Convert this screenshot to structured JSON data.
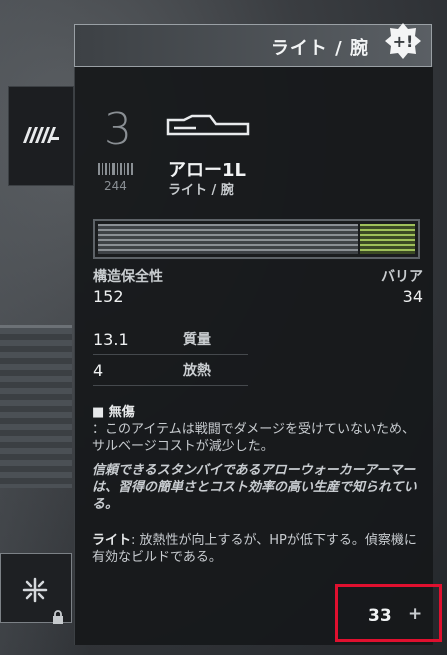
{
  "header": {
    "title": "ライト / 腕"
  },
  "item": {
    "tier": "3",
    "serial": "244",
    "name": "アロー1L",
    "subtitle": "ライト / 腕",
    "durability_fraction": 0.82,
    "barrier_fraction": 0.18
  },
  "stats": {
    "structure_label": "構造保全性",
    "structure_value": "152",
    "barrier_label": "バリア",
    "barrier_value": "34",
    "mass_value": "13.1",
    "mass_label": "質量",
    "heat_value": "4",
    "heat_label": "放熱"
  },
  "description": {
    "condition_title": "■ 無傷",
    "condition_text": "：このアイテムは戦闘でダメージを受けていないため、サルベージコストが減少した。",
    "flavor_text": "信頼できるスタンバイであるアローウォーカーアーマーは、習得の簡単さとコスト効率の高い生産で知られている。",
    "class_lead": "ライト",
    "class_text": ": 放熱性が向上するが、HPが低下する。偵察機に有効なビルドである。"
  },
  "counter": {
    "value": "33",
    "plus": "+"
  },
  "colors": {
    "highlight": "#e0102f",
    "barrier": "#9ec05a"
  },
  "icons": {
    "side_tab": "armor-parts-icon",
    "badge": "plus-badge-icon",
    "part": "arm-part-icon",
    "slot": "snowflake-icon",
    "lock": "lock-icon"
  }
}
